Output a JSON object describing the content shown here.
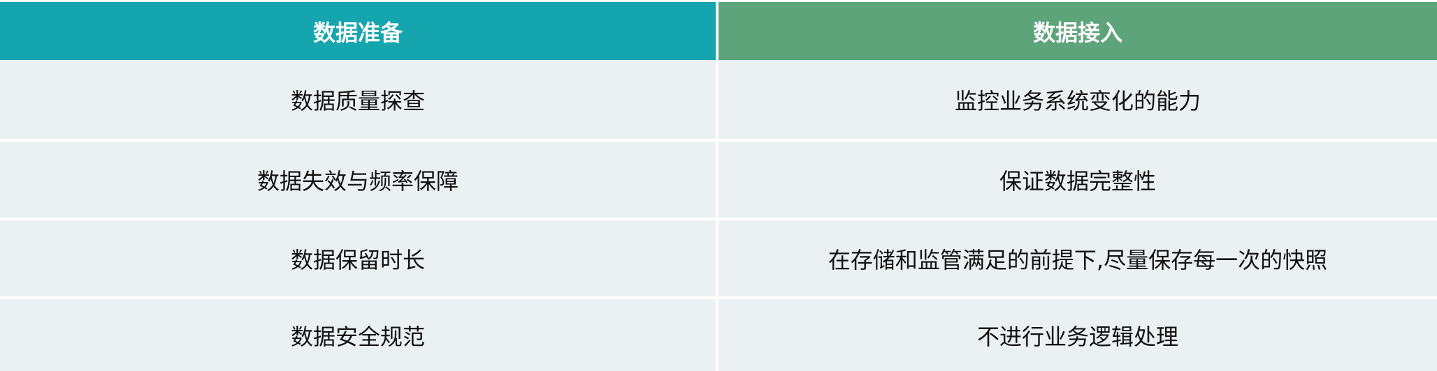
{
  "header": {
    "left": "数据准备",
    "right": "数据接入"
  },
  "rows": [
    {
      "left": "数据质量探查",
      "right": "监控业务系统变化的能力"
    },
    {
      "left": "数据失效与频率保障",
      "right": "保证数据完整性"
    },
    {
      "left": "数据保留时长",
      "right": "在存储和监管满足的前提下,尽量保存每一次的快照"
    },
    {
      "left": "数据安全规范",
      "right": "不进行业务逻辑处理"
    }
  ],
  "colors": {
    "left_header": "#15a5ae",
    "right_header": "#5da47a",
    "row_bg": "#ebf0f2",
    "text": "#111111"
  }
}
